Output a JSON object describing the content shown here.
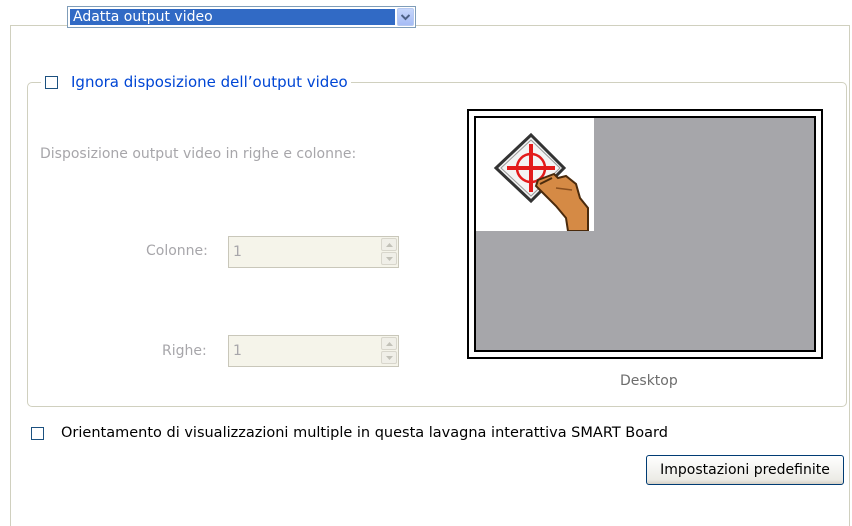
{
  "dropdown": {
    "selected": "Adatta output video"
  },
  "group": {
    "legend_checkbox_label": "Ignora disposizione dell’output video",
    "legend_checked": false
  },
  "layout": {
    "description": "Disposizione output video in righe e colonne:",
    "columns_label": "Colonne:",
    "columns_value": "1",
    "rows_label": "Righe:",
    "rows_value": "1"
  },
  "preview": {
    "caption": "Desktop"
  },
  "orientation": {
    "label": "Orientamento di visualizzazioni multiple in questa lavagna interattiva SMART Board",
    "checked": false
  },
  "buttons": {
    "defaults_label": "Impostazioni predefinite"
  },
  "colors": {
    "selection": "#316ac5",
    "legend_text": "#0046d5",
    "disabled_text": "#a7a6aa",
    "preview_gray": "#a6a6aa"
  }
}
